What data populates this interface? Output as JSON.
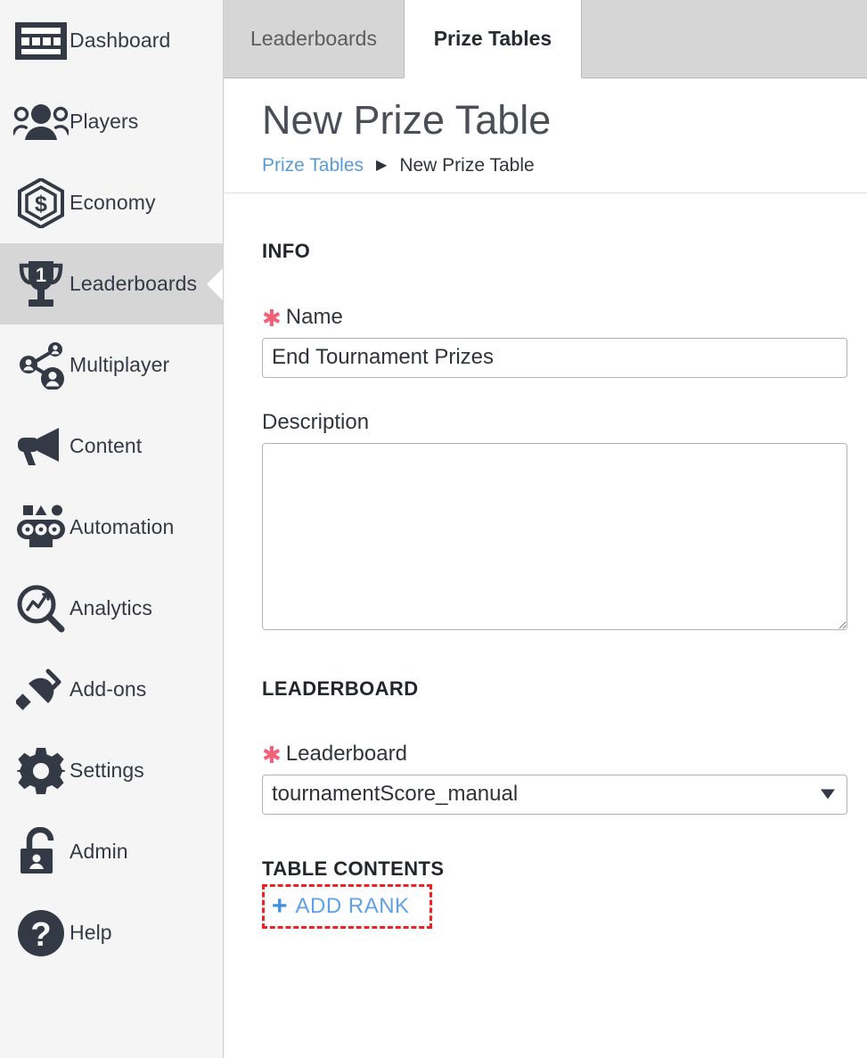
{
  "sidebar": {
    "items": [
      {
        "label": "Dashboard",
        "icon": "dashboard-icon",
        "active": false
      },
      {
        "label": "Players",
        "icon": "players-icon",
        "active": false
      },
      {
        "label": "Economy",
        "icon": "economy-icon",
        "active": false
      },
      {
        "label": "Leaderboards",
        "icon": "trophy-icon",
        "active": true
      },
      {
        "label": "Multiplayer",
        "icon": "multiplayer-icon",
        "active": false
      },
      {
        "label": "Content",
        "icon": "megaphone-icon",
        "active": false
      },
      {
        "label": "Automation",
        "icon": "automation-icon",
        "active": false
      },
      {
        "label": "Analytics",
        "icon": "magnifier-chart-icon",
        "active": false
      },
      {
        "label": "Add-ons",
        "icon": "plug-icon",
        "active": false
      },
      {
        "label": "Settings",
        "icon": "gear-icon",
        "active": false
      },
      {
        "label": "Admin",
        "icon": "lock-user-icon",
        "active": false
      },
      {
        "label": "Help",
        "icon": "question-circle-icon",
        "active": false
      }
    ]
  },
  "tabs": [
    {
      "label": "Leaderboards",
      "active": false
    },
    {
      "label": "Prize Tables",
      "active": true
    }
  ],
  "header": {
    "title": "New Prize Table",
    "breadcrumb": {
      "parent": "Prize Tables",
      "separator": "▶",
      "current": "New Prize Table"
    }
  },
  "form": {
    "info_section_title": "INFO",
    "name_label": "Name",
    "name_required_marker": "✱",
    "name_value": "End Tournament Prizes",
    "name_placeholder": "",
    "description_label": "Description",
    "description_value": "",
    "description_placeholder": "",
    "leaderboard_section_title": "LEADERBOARD",
    "leaderboard_label": "Leaderboard",
    "leaderboard_required_marker": "✱",
    "leaderboard_value": "tournamentScore_manual",
    "leaderboard_options": [
      "tournamentScore_manual"
    ],
    "table_contents_title": "TABLE CONTENTS",
    "add_rank_plus": "+",
    "add_rank_label": "ADD RANK"
  },
  "colors": {
    "sidebar_bg": "#f5f5f5",
    "sidebar_active_bg": "#d6d6d6",
    "tabbar_bg": "#d6d6d6",
    "icon_dark": "#343a45",
    "link_blue": "#5b9bd5",
    "required_pink": "#f2607a",
    "highlight_red": "#ee2222",
    "add_rank_blue": "#5fa0e8"
  }
}
